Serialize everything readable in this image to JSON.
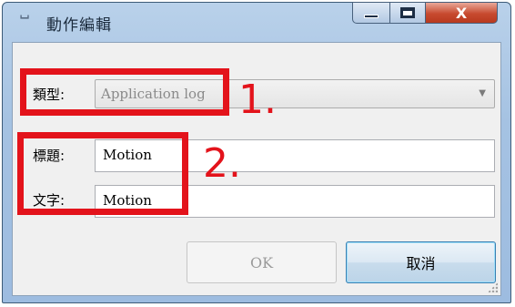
{
  "window": {
    "title": "動作編輯",
    "controls": {
      "minimize": "minimize",
      "maximize": "maximize",
      "close": "X"
    }
  },
  "form": {
    "type": {
      "label": "類型:",
      "value": "Application log",
      "enabled": false
    },
    "title_field": {
      "label": "標題:",
      "value": "Motion"
    },
    "text_field": {
      "label": "文字:",
      "value": "Motion"
    }
  },
  "buttons": {
    "ok": {
      "label": "OK",
      "enabled": false
    },
    "cancel": {
      "label": "取消",
      "enabled": true
    }
  },
  "annotations": {
    "marker_1": "1.",
    "marker_2": "2.",
    "color": "#e3131b"
  }
}
